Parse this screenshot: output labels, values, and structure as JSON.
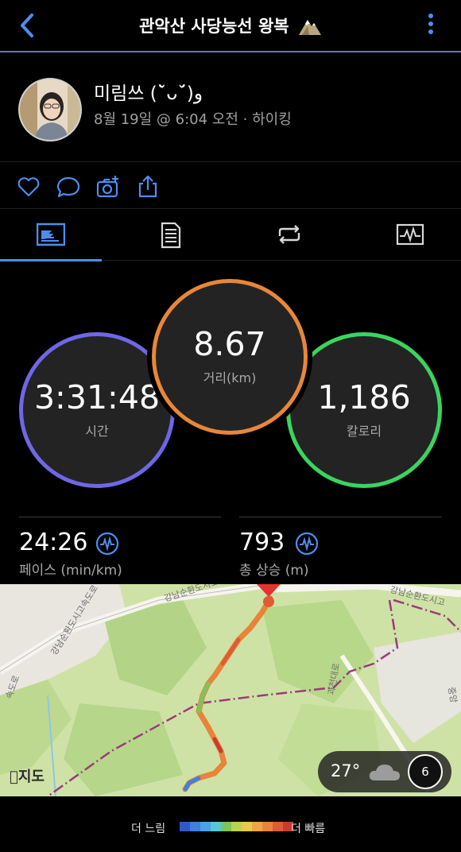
{
  "header": {
    "title": "관악산 사당능선 왕복",
    "back_icon": "chevron-left-icon",
    "more_icon": "more-vertical-icon",
    "title_icon": "mountain-icon"
  },
  "profile": {
    "name": "미림쓰 (˘̀ᴗ˘́)و",
    "meta": "8월 19일 @ 6:04 오전 · 하이킹"
  },
  "actions": [
    "heart-icon",
    "comment-icon",
    "camera-add-icon",
    "share-icon"
  ],
  "tabs": [
    {
      "id": "overview",
      "icon": "overview-icon",
      "active": true
    },
    {
      "id": "details",
      "icon": "document-icon",
      "active": false
    },
    {
      "id": "laps",
      "icon": "repeat-icon",
      "active": false
    },
    {
      "id": "charts",
      "icon": "chart-icon",
      "active": false
    }
  ],
  "rings": {
    "time": {
      "value": "3:31:48",
      "label": "시간",
      "color": "#7066e6"
    },
    "distance": {
      "value": "8.67",
      "label": "거리(km)",
      "color": "#e8873a"
    },
    "calories": {
      "value": "1,186",
      "label": "칼로리",
      "color": "#3bd45e"
    }
  },
  "stats": [
    {
      "value": "24:26",
      "label": "페이스 (min/km)"
    },
    {
      "value": "793",
      "label": "총 상승 (m)"
    }
  ],
  "map": {
    "credit": "지도",
    "road_labels": [
      "강남순환도시고속도로",
      "강남순환도시고속도로",
      "강남순환도시고",
      "과천대로",
      "속도로",
      "중앙"
    ],
    "weather": {
      "temp": "27°",
      "wind": "6"
    }
  },
  "legend": {
    "slow": "더 느림",
    "fast": "더 빠름",
    "colors": [
      "#2f59c9",
      "#3f7fe0",
      "#4aa2e8",
      "#55c8d8",
      "#7cc55a",
      "#b9d34a",
      "#e8c94a",
      "#eea640",
      "#e8843a",
      "#e05b34",
      "#cc3a2e"
    ]
  }
}
